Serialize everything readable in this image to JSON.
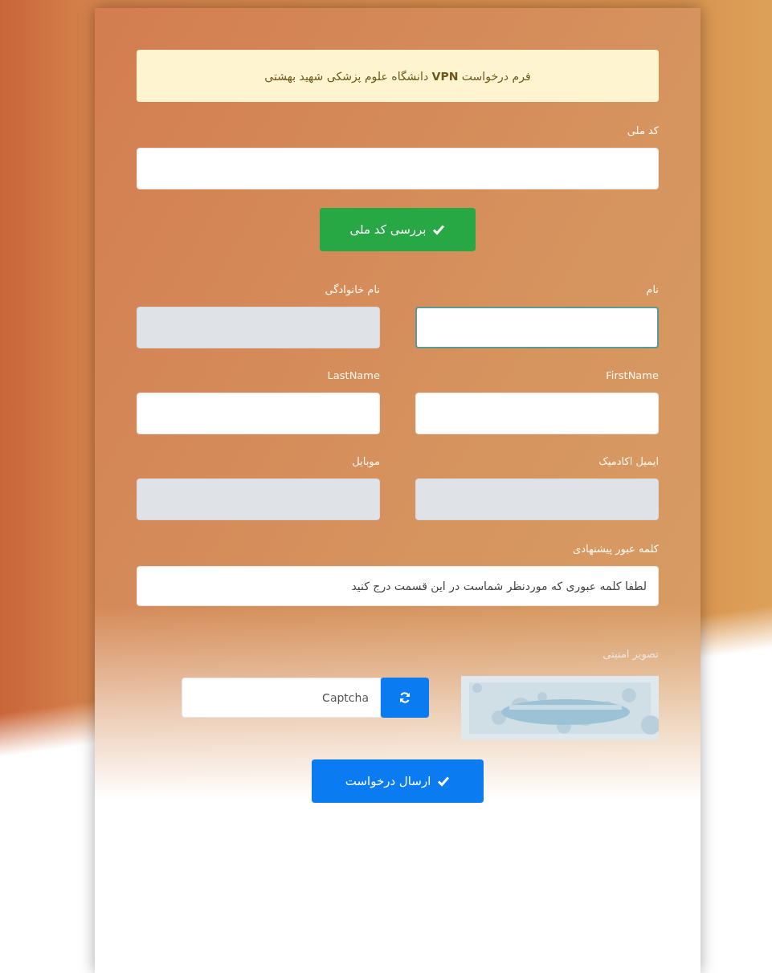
{
  "alert": {
    "text": "فرم درخواست **VPN** دانشگاه علوم پزشکی شهید بهشتی"
  },
  "national_code": {
    "label": "کد ملی",
    "disabled": false
  },
  "check_button": {
    "label": "بررسی کد ملی"
  },
  "fields": [
    {
      "label": "نام",
      "disabled": false,
      "focused": true
    },
    {
      "label": "نام خانوادگی",
      "disabled": true,
      "focused": false
    },
    {
      "label": "FirstName",
      "disabled": false,
      "focused": false
    },
    {
      "label": "LastName",
      "disabled": false,
      "focused": false
    },
    {
      "label": "ایمیل اکادمیک",
      "disabled": true,
      "focused": false
    },
    {
      "label": "موبایل",
      "disabled": true,
      "focused": false
    }
  ],
  "password": {
    "label": "کلمه عبور پیشنهادی",
    "placeholder": "لطفا کلمه عبوری که موردنظر شماست در این قسمت درج کنید"
  },
  "captcha": {
    "label": "تصویر امنیتی",
    "placeholder": "Captcha"
  },
  "submit_button": {
    "label": "ارسال درخواست"
  }
}
